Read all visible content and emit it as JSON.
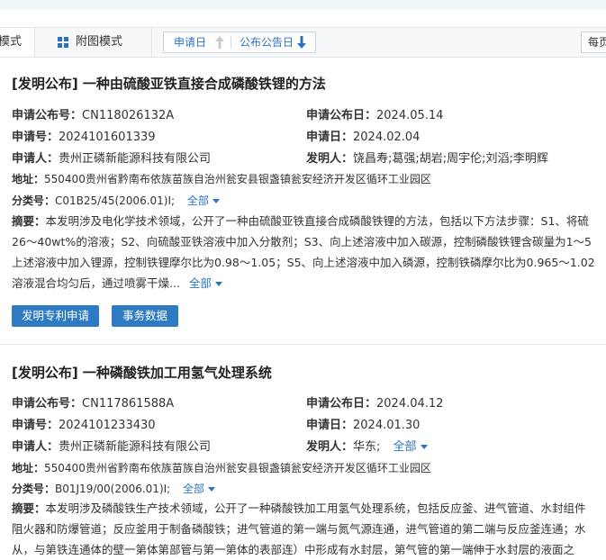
{
  "toolbar": {
    "mode_left_label": "模式",
    "mode_attach_label": "附图模式",
    "sort_apply_label": "申请日",
    "sort_pub_label": "公布公告日",
    "per_page_label": "每页"
  },
  "records": [
    {
      "title": "[发明公布] 一种由硫酸亚铁直接合成磷酸铁锂的方法",
      "pub_no_label": "申请公布号：",
      "pub_no": "CN118026132A",
      "pub_date_label": "申请公布日：",
      "pub_date": "2024.05.14",
      "app_no_label": "申请号：",
      "app_no": "2024101601339",
      "app_date_label": "申请日：",
      "app_date": "2024.02.04",
      "applicant_label": "申请人：",
      "applicant": "贵州正磷新能源科技有限公司",
      "inventor_label": "发明人：",
      "inventor": "饶昌寿;葛强;胡岩;周宇伦;刘滔;李明辉",
      "address_label": "地址：",
      "address": "550400贵州省黔南布依族苗族自治州瓮安县银盏镇瓮安经济开发区循环工业园区",
      "class_label": "分类号：",
      "class_no": "C01B25/45(2006.01)I;",
      "class_more": "全部",
      "abstract_label": "摘要：",
      "abstract_lines": [
        "本发明涉及电化学技术领域，公开了一种由硫酸亚铁直接合成磷酸铁锂的方法，包括以下方法步骤：S1、将硫",
        "26～40wt%的溶液；S2、向硫酸亚铁溶液中加入分散剂；S3、向上述溶液中加入碳源，控制磷酸铁锂含碳量为1～5",
        "上述溶液中加入锂源，控制铁锂摩尔比为0.98～1.05；S5、向上述溶液中加入磷源，控制铁磷摩尔比为0.965～1.02",
        "溶液混合均匀后，通过喷雾干燥..."
      ],
      "abstract_more": "全部",
      "buttons": [
        "发明专利申请",
        "事务数据"
      ]
    },
    {
      "title": "[发明公布] 一种磷酸铁加工用氢气处理系统",
      "pub_no_label": "申请公布号：",
      "pub_no": "CN117861588A",
      "pub_date_label": "申请公布日：",
      "pub_date": "2024.04.12",
      "app_no_label": "申请号：",
      "app_no": "2024101233430",
      "app_date_label": "申请日：",
      "app_date": "2024.01.30",
      "applicant_label": "申请人：",
      "applicant": "贵州正磷新能源科技有限公司",
      "inventor_label": "发明人：",
      "inventor": "华东;",
      "inventor_more": "全部",
      "address_label": "地址：",
      "address": "550400贵州省黔南布依族苗族自治州瓮安县银盏镇瓮安经济开发区循环工业园区",
      "class_label": "分类号：",
      "class_no": "B01J19/00(2006.01)I;",
      "class_more": "全部",
      "abstract_label": "摘要：",
      "abstract_lines": [
        "本发明涉及磷酸铁生产技术领域，公开了一种磷酸铁加工用氢气处理系统，包括反应釜、进气管道、水封组件",
        "阻火器和防爆管道；反应釜用于制备磷酸铁；进气管道的第一端与氮气源连通，进气管道的第二端与反应釜连通；水",
        "从，与第铁连通体的壁一第体第部管与第一第体的表部连）中形成有水封层，第气管的第一端伸于水封层的液面之"
      ]
    }
  ]
}
